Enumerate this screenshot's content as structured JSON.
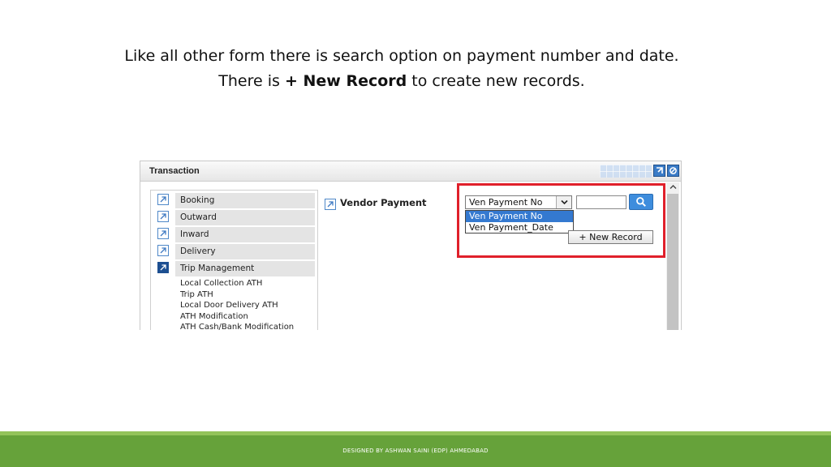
{
  "caption": {
    "line1": "Like all other form there is search option on payment number and date.",
    "line2_before": "There is ",
    "line2_bold": "+ New Record",
    "line2_after": " to create new records."
  },
  "window": {
    "title": "Transaction",
    "buttons": [
      "expand-icon",
      "settings-icon"
    ]
  },
  "menu": {
    "items": [
      {
        "label": "Booking",
        "icon": "link-arrow-icon",
        "active": false
      },
      {
        "label": "Outward",
        "icon": "link-arrow-icon",
        "active": false
      },
      {
        "label": "Inward",
        "icon": "link-arrow-icon",
        "active": false
      },
      {
        "label": "Delivery",
        "icon": "link-arrow-icon",
        "active": false
      },
      {
        "label": "Trip Management",
        "icon": "link-arrow-icon",
        "active": true
      }
    ],
    "sub_items": [
      "Local Collection ATH",
      "Trip ATH",
      "Local Door Delivery ATH",
      "ATH Modification",
      "ATH Cash/Bank Modification"
    ]
  },
  "form": {
    "title": "Vendor Payment",
    "search_by": {
      "selected": "Ven Payment No",
      "options": [
        "Ven Payment No",
        "Ven Payment_Date"
      ]
    },
    "search_value": "",
    "search_button_icon": "search-icon",
    "new_record_label": "+ New Record"
  },
  "colors": {
    "highlight": "#e0202b",
    "footer": "#66a23a",
    "accent": "#3479d0"
  },
  "footer": {
    "text": "DESIGNED BY ASHWAN SAINI (EDP) AHMEDABAD"
  }
}
